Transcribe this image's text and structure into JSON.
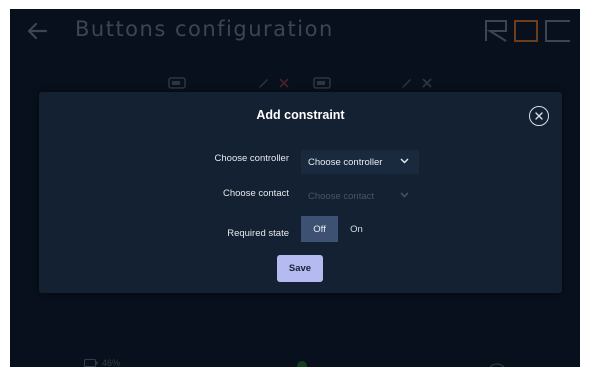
{
  "header": {
    "title": "Buttons configuration",
    "logo_alt": "ROC",
    "back_icon": "arrow-left-icon"
  },
  "dialog": {
    "title": "Add constraint",
    "close_icon": "close-circle-icon",
    "fields": {
      "controller": {
        "label": "Choose controller",
        "value": "Choose controller"
      },
      "contact": {
        "label": "Choose contact",
        "value": "Choose contact",
        "disabled": true
      },
      "required_state": {
        "label": "Required state",
        "options": [
          "Off",
          "On"
        ],
        "selected": "Off"
      }
    },
    "save_label": "Save"
  },
  "status": {
    "battery": "46%"
  },
  "colors": {
    "background": "#0a1422",
    "dialog": "#132132",
    "toggle_active": "#3d5273",
    "save_button": "#b5bbf0",
    "logo_accent": "#e07a2f"
  }
}
